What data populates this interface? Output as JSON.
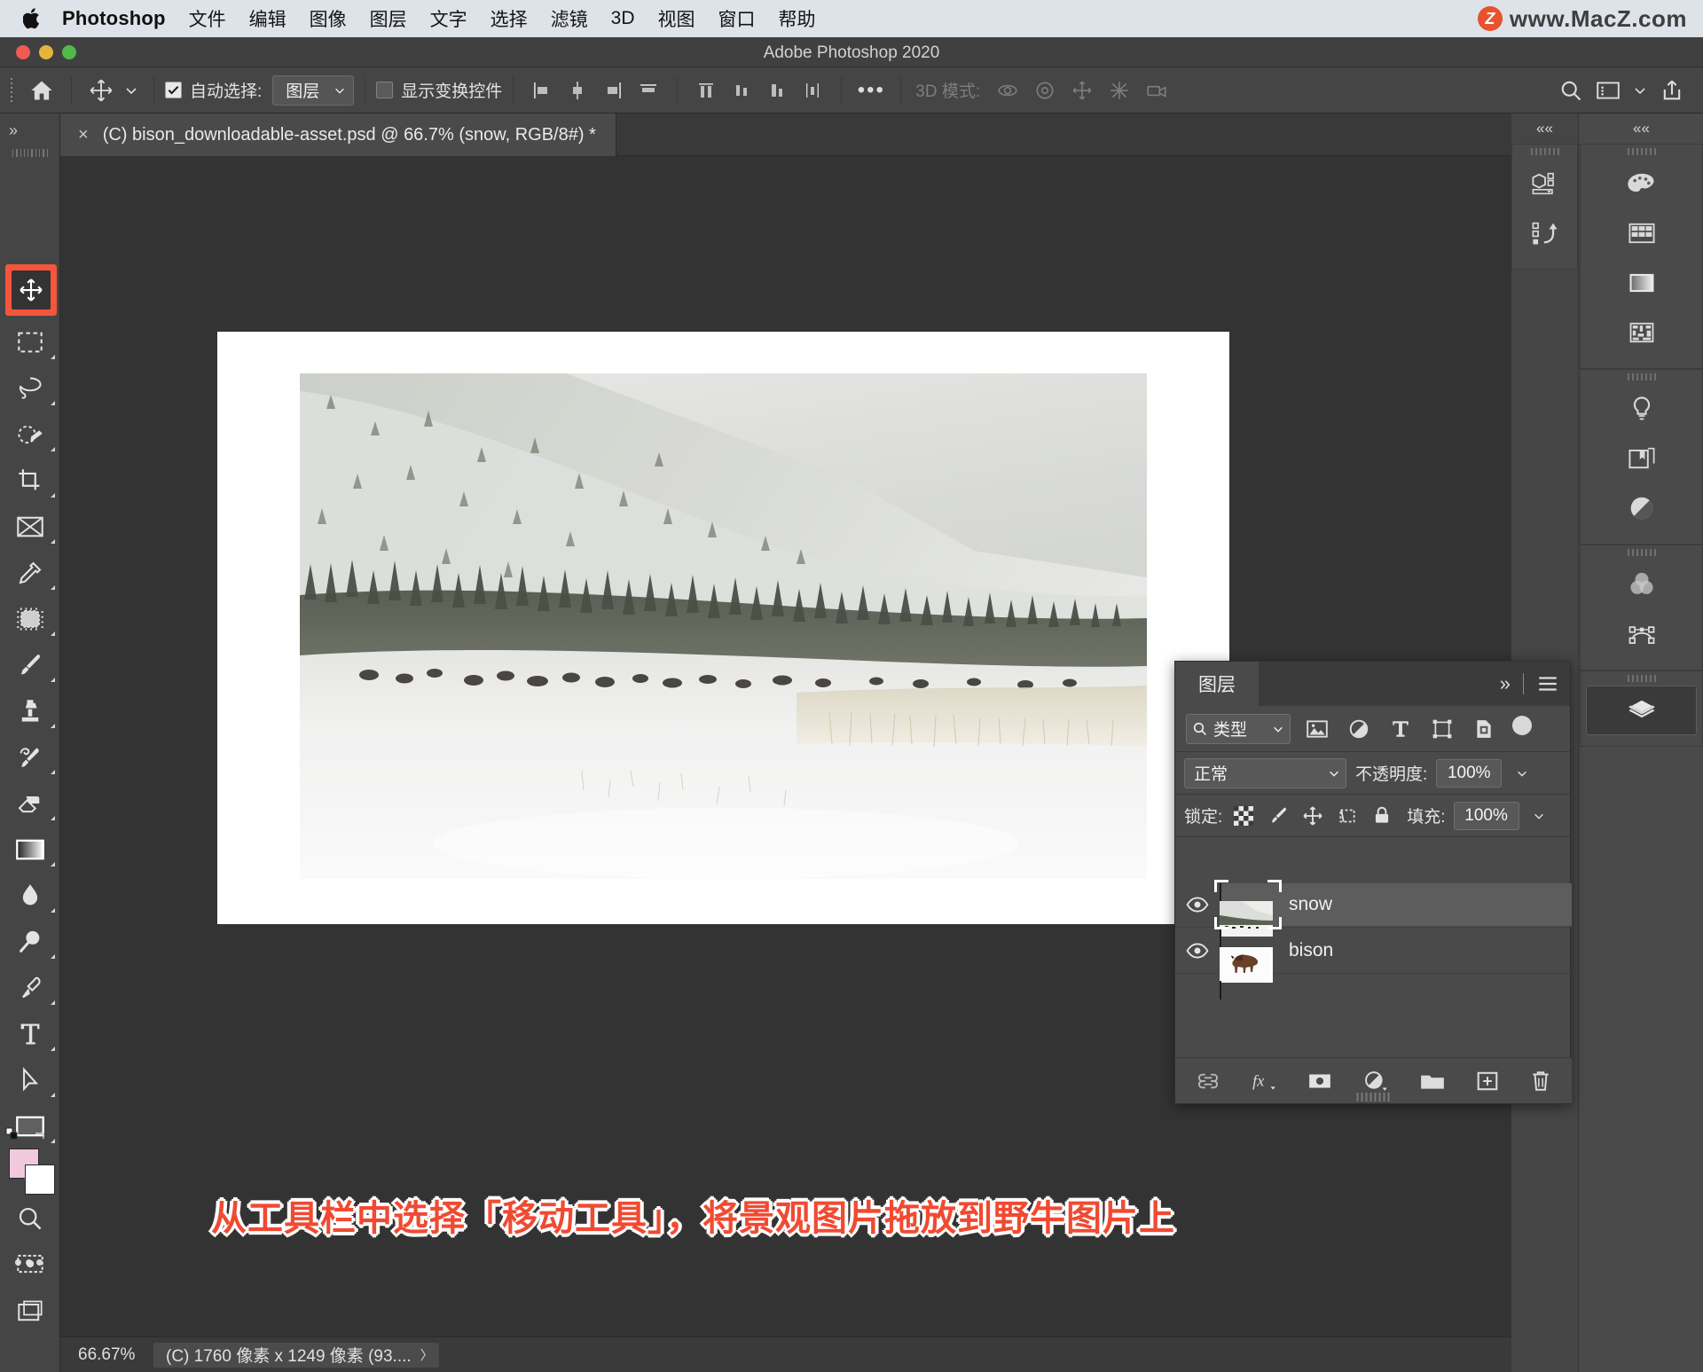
{
  "macbar": {
    "app_name": "Photoshop",
    "menus": [
      "文件",
      "编辑",
      "图像",
      "图层",
      "文字",
      "选择",
      "滤镜",
      "3D",
      "视图",
      "窗口",
      "帮助"
    ],
    "watermark_badge": "Z",
    "watermark_text": "www.MacZ.com"
  },
  "titlebar": {
    "title": "Adobe Photoshop 2020"
  },
  "optionsbar": {
    "home_icon": "home-icon",
    "tool_icon": "move-tool-icon",
    "auto_select_label": "自动选择:",
    "auto_select_checked": true,
    "auto_select_value": "图层",
    "show_transform_label": "显示变换控件",
    "show_transform_checked": false,
    "align_left_icon": "align-left-icon",
    "align_hcenter_icon": "align-horizontal-center-icon",
    "align_right_icon": "align-right-icon",
    "align_top_icon": "align-top-icon",
    "distribute_top_icon": "distribute-top-icon",
    "distribute_vcenter_icon": "distribute-vertical-center-icon",
    "distribute_bottom_icon": "distribute-bottom-icon",
    "distribute_spacing_icon": "distribute-spacing-icon",
    "more_label": "•••",
    "mode_3d_label": "3D 模式:",
    "search_icon": "search-icon",
    "workspace_icon": "workspace-icon",
    "share_icon": "share-icon"
  },
  "document_tab": {
    "close_label": "×",
    "title": "(C) bison_downloadable-asset.psd @ 66.7% (snow, RGB/8#) *"
  },
  "toolbar": {
    "collapse_label": "»",
    "tools": [
      {
        "name": "move-tool",
        "icon": "move-tool-icon",
        "active": true
      },
      {
        "name": "rectangular-marquee-tool",
        "icon": "marquee-icon",
        "active": false
      },
      {
        "name": "lasso-tool",
        "icon": "lasso-icon",
        "active": false
      },
      {
        "name": "quick-selection-tool",
        "icon": "quick-selection-icon",
        "active": false
      },
      {
        "name": "crop-tool",
        "icon": "crop-icon",
        "active": false
      },
      {
        "name": "frame-tool",
        "icon": "frame-icon",
        "active": false
      },
      {
        "name": "eyedropper-tool",
        "icon": "eyedropper-icon",
        "active": false
      },
      {
        "name": "spot-healing-brush-tool",
        "icon": "healing-brush-icon",
        "active": false
      },
      {
        "name": "brush-tool",
        "icon": "brush-icon",
        "active": false
      },
      {
        "name": "clone-stamp-tool",
        "icon": "clone-stamp-icon",
        "active": false
      },
      {
        "name": "history-brush-tool",
        "icon": "history-brush-icon",
        "active": false
      },
      {
        "name": "eraser-tool",
        "icon": "eraser-icon",
        "active": false
      },
      {
        "name": "gradient-tool",
        "icon": "gradient-icon",
        "active": false
      },
      {
        "name": "blur-tool",
        "icon": "blur-drop-icon",
        "active": false
      },
      {
        "name": "dodge-tool",
        "icon": "dodge-icon",
        "active": false
      },
      {
        "name": "pen-tool",
        "icon": "pen-icon",
        "active": false
      },
      {
        "name": "type-tool",
        "icon": "type-t-icon",
        "active": false
      },
      {
        "name": "path-selection-tool",
        "icon": "path-arrow-icon",
        "active": false
      },
      {
        "name": "rectangle-tool",
        "icon": "rectangle-icon",
        "active": false
      },
      {
        "name": "hand-tool",
        "icon": "hand-icon",
        "active": false
      },
      {
        "name": "zoom-tool",
        "icon": "zoom-magnifier-icon",
        "active": false
      }
    ],
    "more_tools_label": "•••",
    "foreground_color": "#f0c9dd",
    "background_color": "#ffffff",
    "quick_mask_icon": "quick-mask-icon",
    "screen_mode_icon": "screen-mode-icon"
  },
  "canvas": {
    "annotation_text": "从工具栏中选择「移动工具」，将景观图片拖放到野牛图片上",
    "annotation_color": "#f04a32"
  },
  "statusbar": {
    "zoom": "66.67%",
    "doc_info": "(C) 1760 像素 x 1249 像素 (93....",
    "doc_info_arrow": "〉"
  },
  "right_dock": {
    "collapse_left_label": "««",
    "collapse_right_label": "««",
    "col_left_icons": [
      "3d-icon",
      "history-icon"
    ],
    "col_right_groups": [
      [
        "color-palette-icon",
        "swatches-grid-icon",
        "gradients-icon",
        "patterns-icon"
      ],
      [
        "adjustments-bulb-icon",
        "libraries-icon",
        "adjustment-halfcircle-icon"
      ],
      [
        "channels-icon",
        "paths-icon"
      ],
      [
        "layers-icon"
      ]
    ]
  },
  "layers_panel": {
    "tab_label": "图层",
    "expand_label": "»",
    "menu_icon": "panel-menu-icon",
    "filter": {
      "kind_label": "类型",
      "search_icon": "search-icon",
      "chevron": "⌄",
      "icons": [
        "pixel-filter-icon",
        "adjustment-filter-icon",
        "type-filter-icon",
        "shape-filter-icon",
        "smart-object-filter-icon"
      ],
      "toggle_icon": "filter-toggle-icon"
    },
    "blend_mode": "正常",
    "opacity_label": "不透明度:",
    "opacity_value": "100%",
    "lock_label": "锁定:",
    "lock_icons": [
      "lock-transparency-icon",
      "lock-image-icon",
      "lock-position-icon",
      "lock-artboard-icon",
      "lock-all-icon"
    ],
    "fill_label": "填充:",
    "fill_value": "100%",
    "layers": [
      {
        "name": "snow",
        "visible": true,
        "selected": true,
        "thumb": "snow-landscape-thumb"
      },
      {
        "name": "bison",
        "visible": true,
        "selected": false,
        "thumb": "bison-thumb"
      }
    ],
    "bottom_icons": [
      "link-layers-icon",
      "layer-style-fx-icon",
      "layer-mask-icon",
      "new-adjustment-layer-icon",
      "new-group-icon",
      "new-layer-icon",
      "delete-layer-icon"
    ]
  }
}
